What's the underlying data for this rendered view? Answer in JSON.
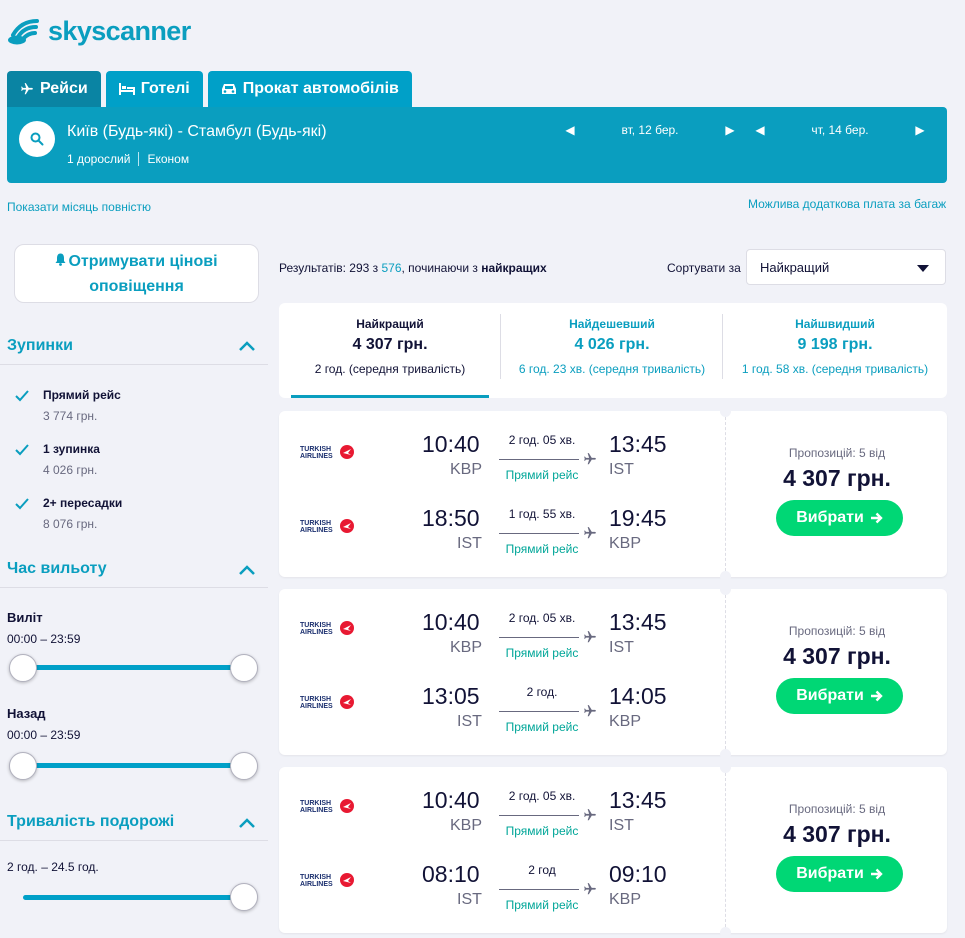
{
  "brand": {
    "name": "skyscanner",
    "color": "#0a9ebf",
    "icon": "cloud-sun-logo-icon"
  },
  "tabs": [
    {
      "label": "Рейси",
      "icon": "plane-icon",
      "active": true
    },
    {
      "label": "Готелі",
      "icon": "bed-icon",
      "active": false
    },
    {
      "label": "Прокат автомобілів",
      "icon": "car-icon",
      "active": false
    }
  ],
  "search": {
    "route": "Київ (Будь-які) - Стамбул (Будь-які)",
    "passengers": "1 дорослий",
    "cabin": "Економ",
    "depart_date": "вт, 12 бер.",
    "return_date": "чт, 14 бер."
  },
  "links": {
    "show_month": "Показати місяць повністю",
    "baggage": "Можлива додаткова плата за багаж"
  },
  "alert": {
    "line1": "Отримувати цінові",
    "line2": "оповіщення"
  },
  "filters": {
    "stops": {
      "title": "Зупинки",
      "options": [
        {
          "label": "Прямий рейс",
          "price": "3 774 грн.",
          "checked": true
        },
        {
          "label": "1 зупинка",
          "price": "4 026 грн.",
          "checked": true
        },
        {
          "label": "2+ пересадки",
          "price": "8 076 грн.",
          "checked": true
        }
      ]
    },
    "departure_time": {
      "title": "Час вильоту",
      "outbound_label": "Виліт",
      "outbound_range": "00:00 – 23:59",
      "return_label": "Назад",
      "return_range": "00:00 – 23:59"
    },
    "duration": {
      "title": "Тривалість подорожі",
      "range": "2 год. – 24.5 год."
    }
  },
  "results_bar": {
    "prefix": "Результатів: 293 з ",
    "total": "576",
    "mid": ", починаючи з ",
    "sort_word": "найкращих",
    "sort_label": "Сортувати за",
    "sort_value": "Найкращий"
  },
  "summary": [
    {
      "title": "Найкращий",
      "price": "4 307 грн.",
      "duration": "2 год. (середня тривалість)",
      "active": true
    },
    {
      "title": "Найдешевший",
      "price": "4 026 грн.",
      "duration": "6 год. 23 хв. (середня тривалість)",
      "active": false
    },
    {
      "title": "Найшвидший",
      "price": "9 198 грн.",
      "duration": "1 год. 58 хв. (середня тривалість)",
      "active": false
    }
  ],
  "airline_logo_text": "TURKISH AIRLINES",
  "cards": [
    {
      "offers": "Пропозицій: 5 від",
      "price": "4 307 грн.",
      "button": "Вибрати",
      "legs": [
        {
          "dep_time": "10:40",
          "dep_ap": "KBP",
          "duration": "2 год. 05 хв.",
          "stops": "Прямий рейс",
          "arr_time": "13:45",
          "arr_ap": "IST"
        },
        {
          "dep_time": "18:50",
          "dep_ap": "IST",
          "duration": "1 год. 55 хв.",
          "stops": "Прямий рейс",
          "arr_time": "19:45",
          "arr_ap": "KBP"
        }
      ]
    },
    {
      "offers": "Пропозицій: 5 від",
      "price": "4 307 грн.",
      "button": "Вибрати",
      "legs": [
        {
          "dep_time": "10:40",
          "dep_ap": "KBP",
          "duration": "2 год. 05 хв.",
          "stops": "Прямий рейс",
          "arr_time": "13:45",
          "arr_ap": "IST"
        },
        {
          "dep_time": "13:05",
          "dep_ap": "IST",
          "duration": "2 год.",
          "stops": "Прямий рейс",
          "arr_time": "14:05",
          "arr_ap": "KBP"
        }
      ]
    },
    {
      "offers": "Пропозицій: 5 від",
      "price": "4 307 грн.",
      "button": "Вибрати",
      "legs": [
        {
          "dep_time": "10:40",
          "dep_ap": "KBP",
          "duration": "2 год. 05 хв.",
          "stops": "Прямий рейс",
          "arr_time": "13:45",
          "arr_ap": "IST"
        },
        {
          "dep_time": "08:10",
          "dep_ap": "IST",
          "duration": "2 год",
          "stops": "Прямий рейс",
          "arr_time": "09:10",
          "arr_ap": "KBP"
        }
      ]
    }
  ],
  "colors": {
    "primary": "#0a9ebf",
    "active_tab": "#0a84a3",
    "cta": "#00d775",
    "stops_green": "#00a698",
    "page_bg": "#f1f2f8",
    "turkish_red": "#e81932"
  }
}
